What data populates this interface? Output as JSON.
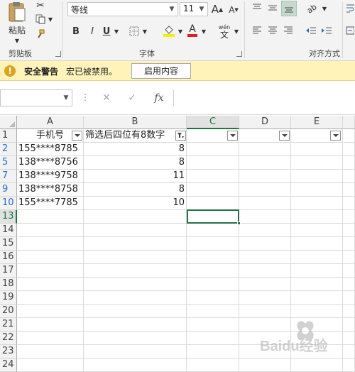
{
  "ribbon": {
    "clipboard": {
      "paste_label": "粘贴",
      "group_label": "剪贴板"
    },
    "font": {
      "font_name": "等线",
      "font_size": "11",
      "group_label": "字体",
      "bold": "B",
      "italic": "I",
      "underline": "U",
      "font_color_glyph": "A",
      "wen_glyph": "wén",
      "zi_glyph": "文"
    },
    "alignment": {
      "group_label": "对齐方式"
    }
  },
  "security_bar": {
    "title": "安全警告",
    "message": "宏已被禁用。",
    "button": "启用内容",
    "icon_glyph": "!"
  },
  "formula_bar": {
    "name_box": "",
    "cancel_glyph": "✕",
    "enter_glyph": "✓",
    "fx_glyph": "fx",
    "value": ""
  },
  "sheet": {
    "columns": [
      "A",
      "B",
      "C",
      "D",
      "E"
    ],
    "header_row": {
      "row": "1",
      "a": "手机号",
      "b": "筛选后四位有8数字"
    },
    "rows": [
      {
        "row": "2",
        "a": "155****8785",
        "b": "8"
      },
      {
        "row": "5",
        "a": "138****8756",
        "b": "8"
      },
      {
        "row": "7",
        "a": "138****9758",
        "b": "11"
      },
      {
        "row": "9",
        "a": "138****8758",
        "b": "8"
      },
      {
        "row": "10",
        "a": "155****7785",
        "b": "10"
      }
    ],
    "empty_rows": [
      "13",
      "14",
      "15",
      "16",
      "17",
      "18",
      "19",
      "20",
      "21",
      "22",
      "23",
      "24"
    ],
    "selected_column": "C",
    "selected_row": "13",
    "accent_color": "#217346"
  },
  "watermark": {
    "text": "Baidu经验"
  }
}
